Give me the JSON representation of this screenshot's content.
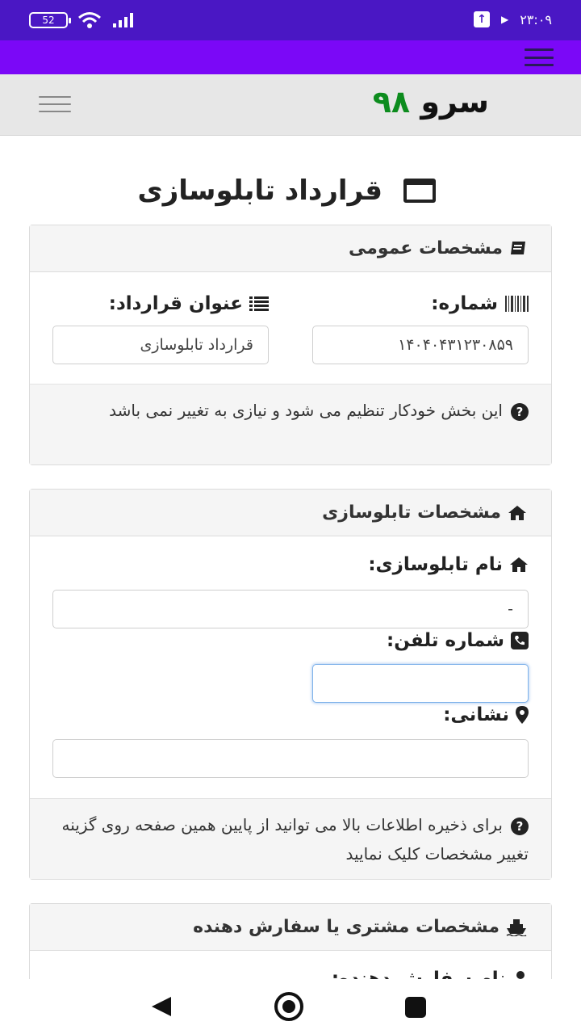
{
  "status_bar": {
    "battery": "52",
    "time": "۲۳:۰۹"
  },
  "header": {
    "logo_word": "سرو",
    "logo_number": "۹۸"
  },
  "page": {
    "title": "قرارداد تابلوسازی"
  },
  "card_general": {
    "header": "مشخصات عمومی",
    "number_label": "شماره:",
    "number_value": "۱۴۰۴۰۴۳۱۲۳۰۸۵۹",
    "title_label": "عنوان قرارداد:",
    "title_value": "قرارداد تابلوسازی",
    "footer": "این بخش خودکار تنظیم می شود و نیازی به تغییر نمی باشد"
  },
  "card_shop": {
    "header": "مشخصات تابلوسازی",
    "shop_name_label": "نام تابلوسازی:",
    "shop_name_value": "-",
    "phone_label": "شماره تلفن:",
    "phone_value": "",
    "address_label": "نشانی:",
    "address_value": "",
    "footer": "برای ذخیره اطلاعات بالا می توانید از پایین همین صفحه روی گزینه تغییر مشخصات کلیک نمایید"
  },
  "card_customer": {
    "header": "مشخصات مشتری یا سفارش دهنده",
    "first_label": "نام سفارش دهنده:"
  },
  "icons": {
    "wifi": "wifi-icon",
    "signal": "signal-icon",
    "upload": "upload-icon",
    "play": "play-icon",
    "menu": "menu-icon",
    "window": "window-icon",
    "book": "book-icon",
    "barcode": "barcode-icon",
    "list": "list-icon",
    "question": "question-circle-icon",
    "home": "home-icon",
    "phone": "phone-icon",
    "map_marker": "map-marker-icon",
    "ship": "ship-icon",
    "user": "user-icon"
  },
  "colors": {
    "status_bar": "#4a17c4",
    "nav_purple": "#7b08f7",
    "logo_green": "#0d8c1e",
    "header_gray": "#e7e7e7"
  }
}
